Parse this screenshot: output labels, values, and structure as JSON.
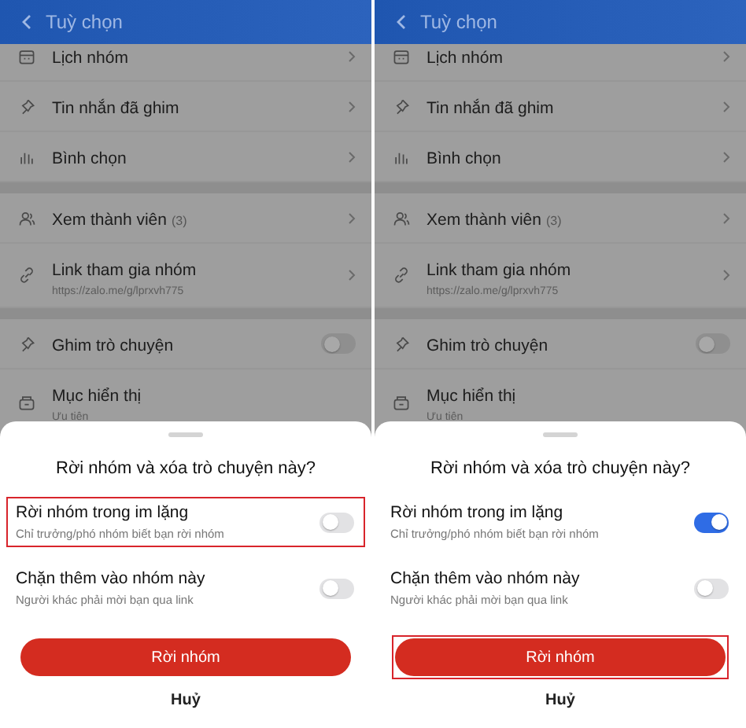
{
  "panels": [
    {
      "header": {
        "title": "Tuỳ chọn"
      },
      "groups": [
        [
          {
            "kind": "link",
            "label": "Lịch nhóm"
          },
          {
            "kind": "link",
            "label": "Tin nhắn đã ghim"
          },
          {
            "kind": "link",
            "label": "Bình chọn"
          }
        ],
        [
          {
            "kind": "link",
            "label": "Xem thành viên",
            "count": "(3)"
          },
          {
            "kind": "link",
            "label": "Link tham gia nhóm",
            "subtitle": "https://zalo.me/g/lprxvh775"
          }
        ],
        [
          {
            "kind": "toggle",
            "label": "Ghim trò chuyện",
            "on": false
          },
          {
            "kind": "plain",
            "label": "Mục hiển thị",
            "subtitle": "Ưu tiên"
          }
        ]
      ],
      "sheet": {
        "title": "Rời nhóm và xóa trò chuyện này?",
        "options": [
          {
            "label": "Rời nhóm trong im lặng",
            "hint": "Chỉ trưởng/phó nhóm biết bạn rời nhóm",
            "on": false,
            "highlighted": true
          },
          {
            "label": "Chặn thêm vào nhóm này",
            "hint": "Người khác phải mời bạn qua link",
            "on": false,
            "highlighted": false
          }
        ],
        "primary_button": {
          "label": "Rời nhóm",
          "highlighted": false
        },
        "cancel": "Huỷ"
      }
    },
    {
      "header": {
        "title": "Tuỳ chọn"
      },
      "groups": [
        [
          {
            "kind": "link",
            "label": "Lịch nhóm"
          },
          {
            "kind": "link",
            "label": "Tin nhắn đã ghim"
          },
          {
            "kind": "link",
            "label": "Bình chọn"
          }
        ],
        [
          {
            "kind": "link",
            "label": "Xem thành viên",
            "count": "(3)"
          },
          {
            "kind": "link",
            "label": "Link tham gia nhóm",
            "subtitle": "https://zalo.me/g/lprxvh775"
          }
        ],
        [
          {
            "kind": "toggle",
            "label": "Ghim trò chuyện",
            "on": false
          },
          {
            "kind": "plain",
            "label": "Mục hiển thị",
            "subtitle": "Ưu tiên"
          }
        ]
      ],
      "sheet": {
        "title": "Rời nhóm và xóa trò chuyện này?",
        "options": [
          {
            "label": "Rời nhóm trong im lặng",
            "hint": "Chỉ trưởng/phó nhóm biết bạn rời nhóm",
            "on": true,
            "highlighted": false
          },
          {
            "label": "Chặn thêm vào nhóm này",
            "hint": "Người khác phải mời bạn qua link",
            "on": false,
            "highlighted": false
          }
        ],
        "primary_button": {
          "label": "Rời nhóm",
          "highlighted": true
        },
        "cancel": "Huỷ"
      }
    }
  ]
}
